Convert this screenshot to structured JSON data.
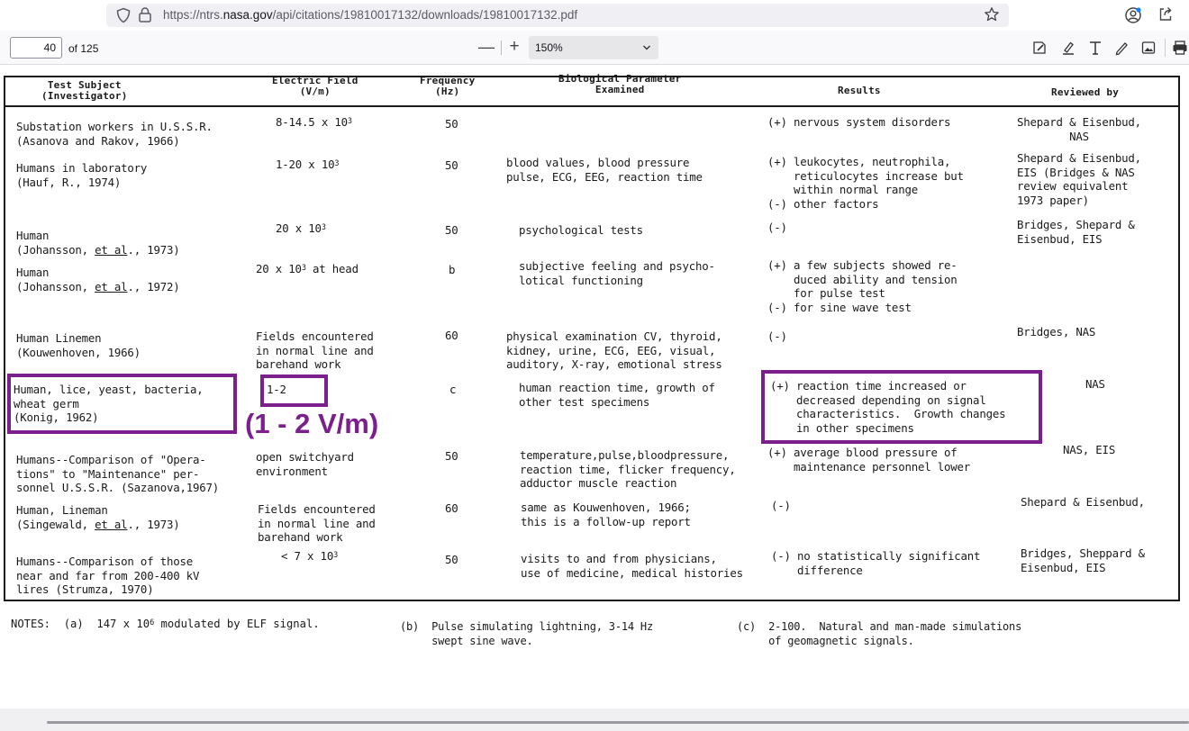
{
  "browser": {
    "url_prefix": "https://ntrs.",
    "url_domain": "nasa.gov",
    "url_suffix": "/api/citations/19810017132/downloads/19810017132.pdf"
  },
  "pdf_toolbar": {
    "page_number": "40",
    "page_count": "of 125",
    "zoom_out": "—",
    "zoom_in": "+",
    "zoom_value": "150%"
  },
  "table": {
    "headers": {
      "subject": "Test Subject\n(Investigator)",
      "field": "Electric Field\n(V/m)",
      "frequency": "Frequency\n(Hz)",
      "parameter": "Biological Parameter\nExamined",
      "results": "Results",
      "reviewed": "Reviewed by"
    },
    "rows": [
      {
        "subject": "Substation workers in U.S.S.R.\n(Asanova and Rakov, 1966)",
        "field": "8-14.5 x 10",
        "field_exp": "3",
        "frequency": "50",
        "parameter": "",
        "results": "(+) nervous system disorders",
        "reviewed": "Shepard & Eisenbud,\n        NAS"
      },
      {
        "subject": "Humans in laboratory\n(Hauf, R., 1974)",
        "field": "1-20 x 10",
        "field_exp": "3",
        "frequency": "50",
        "parameter": "blood values, blood pressure\npulse, ECG, EEG, reaction time",
        "results": "(+) leukocytes, neutrophila,\n    reticulocytes increase but\n    within normal range\n(-) other factors",
        "reviewed": "Shepard & Eisenbud,\nEIS (Bridges & NAS\nreview equivalent\n1973 paper)"
      },
      {
        "subject_line1": "Human",
        "subject_line2a": "(Johansson, ",
        "subject_et_al": "et al",
        "subject_line2b": "., 1973)",
        "field": "20 x 10",
        "field_exp": "3",
        "frequency": "50",
        "parameter": "psychological tests",
        "results": "(-)",
        "reviewed": "Bridges, Shepard &\nEisenbud, EIS"
      },
      {
        "subject_line1": "Human",
        "subject_line2a": "(Johansson, ",
        "subject_et_al": "et al",
        "subject_line2b": "., 1972)",
        "field": "20 x 10",
        "field_exp": "3",
        "field_tail": " at head",
        "frequency": "b",
        "parameter": "subjective feeling and psycho-\nlotical functioning",
        "results": "(+) a few subjects showed re-\n    duced ability and tension\n    for pulse test\n(-) for sine wave test",
        "reviewed": ""
      },
      {
        "subject": "Human Linemen\n(Kouwenhoven, 1966)",
        "field": "Fields encountered\nin normal line and\nbarehand work",
        "frequency": "60",
        "parameter": "physical examination CV, thyroid,\nkidney, urine, ECG, EEG, visual,\nauditory, X-ray, emotional stress",
        "results": "(-)",
        "reviewed": "Bridges, NAS"
      },
      {
        "subject": "Human, lice, yeast, bacteria,\nwheat germ\n(Konig, 1962)",
        "field": "1-2",
        "frequency": "c",
        "parameter": "human reaction time, growth of\nother test specimens",
        "results": "(+) reaction time increased or\n    decreased depending on signal\n    characteristics.  Growth changes\n    in other specimens",
        "reviewed": "NAS"
      },
      {
        "subject": "Humans--Comparison of \"Opera-\ntions\" to \"Maintenance\" per-\nsonnel U.S.S.R. (Sazanova,1967)",
        "field": "open switchyard\nenvironment",
        "frequency": "50",
        "parameter": "temperature,pulse,bloodpressure,\nreaction time, flicker frequency,\nadductor muscle reaction",
        "results": "(+) average blood pressure of\n    maintenance personnel lower",
        "reviewed": "NAS, EIS"
      },
      {
        "subject_line1": "Human, Lineman",
        "subject_line2a": "(Singewald, ",
        "subject_et_al": "et al",
        "subject_line2b": "., 1973)",
        "field": "Fields encountered\nin normal line and\nbarehand work",
        "frequency": "60",
        "parameter": "same as Kouwenhoven, 1966;\nthis is a follow-up report",
        "results": "(-)",
        "reviewed": "Shepard & Eisenbud,"
      },
      {
        "subject": "Humans--Comparison of those\nnear and far from 200-400 kV\nlires (Strumza, 1970)",
        "field": "< 7 x 10",
        "field_exp": "3",
        "frequency": "50",
        "parameter": "visits to and from physicians,\nuse of medicine, medical histories",
        "results": "(-) no statistically significant\n    difference",
        "reviewed": "Bridges, Sheppard &\nEisenbud, EIS"
      }
    ]
  },
  "annotation": {
    "callout": "(1 - 2 V/m)"
  },
  "notes": {
    "a_prefix": "NOTES:  (a)  147 x 10",
    "a_exp": "6",
    "a_suffix": " modulated by ELF signal.",
    "b": "(b)  Pulse simulating lightning, 3-14 Hz\n     swept sine wave.",
    "c": "(c)  2-100.  Natural and man-made simulations\n     of geomagnetic signals."
  },
  "colors": {
    "highlight": "#7b1f8c",
    "toolbar_bg": "#f9f9fb",
    "url_field_bg": "#f0f0f4"
  }
}
